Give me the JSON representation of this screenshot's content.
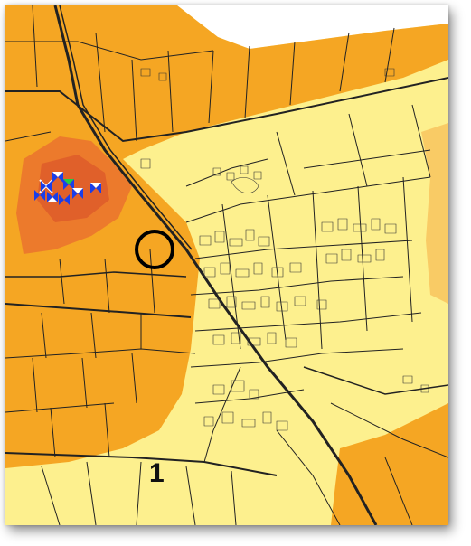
{
  "map": {
    "label": "1",
    "colors": {
      "background_low": "#fdf08e",
      "zone_medium": "#f5a623",
      "zone_high": "#ec7a2c",
      "zone_high_core": "#e0602a",
      "white_area": "#ffffff",
      "line_color": "#222222",
      "marker_circle": "#000000",
      "marker_blue": "#1a3ee8",
      "marker_green": "#22cc44"
    },
    "features": {
      "highlight_circle": "circle-marker",
      "wind_turbine_symbols": "turbine-icons"
    }
  }
}
